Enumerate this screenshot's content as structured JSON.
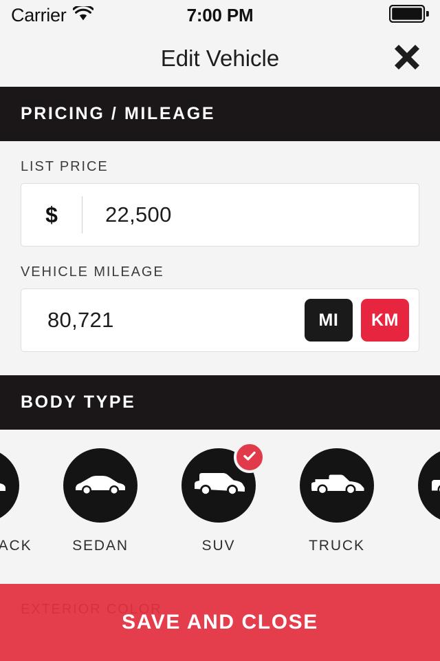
{
  "status_bar": {
    "carrier": "Carrier",
    "time": "7:00 PM",
    "wifi_icon": "wifi-icon",
    "battery_icon": "battery-full-icon"
  },
  "header": {
    "title": "Edit Vehicle",
    "close_icon": "close-x-icon"
  },
  "sections": {
    "pricing": {
      "heading": "PRICING / MILEAGE",
      "list_price": {
        "label": "LIST PRICE",
        "currency_symbol": "$",
        "value": "22,500",
        "placeholder": "0"
      },
      "mileage": {
        "label": "VEHICLE MILEAGE",
        "value": "80,721",
        "placeholder": "0",
        "units": [
          {
            "label": "MI",
            "selected": false
          },
          {
            "label": "KM",
            "selected": true
          }
        ]
      }
    },
    "body_type": {
      "heading": "BODY TYPE",
      "items": [
        {
          "label": "HATCHBACK",
          "icon": "car-hatchback-icon",
          "selected": false,
          "partial": "left"
        },
        {
          "label": "SEDAN",
          "icon": "car-sedan-icon",
          "selected": false
        },
        {
          "label": "SUV",
          "icon": "car-suv-icon",
          "selected": true
        },
        {
          "label": "TRUCK",
          "icon": "car-truck-icon",
          "selected": false
        },
        {
          "label": "",
          "icon": "car-van-icon",
          "selected": false,
          "partial": "right"
        }
      ],
      "selected_badge_icon": "check-circle-icon"
    },
    "exterior_color": {
      "label": "EXTERIOR COLOR"
    }
  },
  "footer": {
    "save_label": "SAVE AND CLOSE"
  },
  "colors": {
    "accent_red": "#e22f40",
    "unit_selected_red": "#e8253e",
    "badge_red": "#e03a4b",
    "dark_bar": "#1b1719",
    "page_background": "#f4f4f4",
    "circle_dark": "#141414"
  }
}
